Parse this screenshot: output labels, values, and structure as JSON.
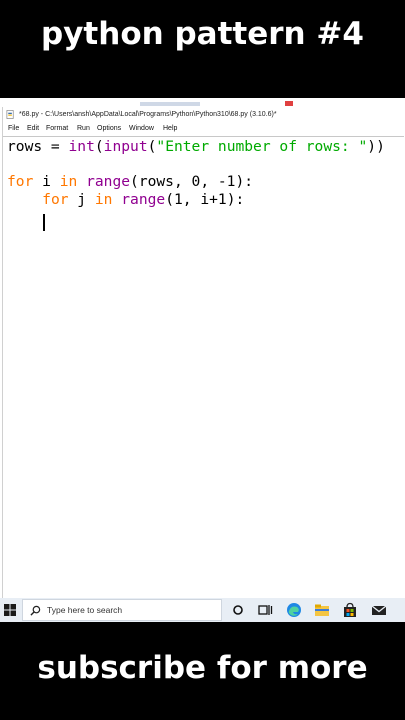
{
  "overlay": {
    "top_title": "python pattern #4",
    "bottom_text": "subscribe for more"
  },
  "window": {
    "title": "*68.py - C:\\Users\\ansh\\AppData\\Local\\Programs\\Python\\Python310\\68.py (3.10.6)*",
    "menu": [
      "File",
      "Edit",
      "Format",
      "Run",
      "Options",
      "Window",
      "Help"
    ]
  },
  "code": {
    "line1": {
      "a": "rows = ",
      "b": "int",
      "c": "(",
      "d": "input",
      "e": "(",
      "f": "\"Enter number of rows: \"",
      "g": "))"
    },
    "line2": {
      "a": "for",
      "b": " i ",
      "c": "in",
      "d": " ",
      "e": "range",
      "f": "(rows, 0, -1):"
    },
    "line3": {
      "a": "    ",
      "b": "for",
      "c": " j ",
      "d": "in",
      "e": " ",
      "f": "range",
      "g": "(1, i+1):"
    }
  },
  "colors": {
    "keyword": "#ff7700",
    "builtin": "#900090",
    "string": "#00aa00"
  },
  "taskbar": {
    "search_placeholder": "Type here to search",
    "icons": [
      "windows-start-icon",
      "search-icon",
      "cortana-icon",
      "task-view-icon",
      "edge-icon",
      "file-explorer-icon",
      "store-icon",
      "mail-icon"
    ]
  }
}
